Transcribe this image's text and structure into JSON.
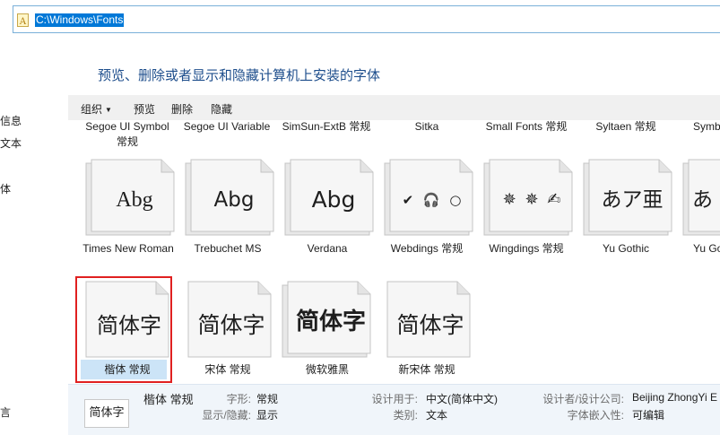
{
  "address_bar": {
    "path": "C:\\Windows\\Fonts"
  },
  "nav": {
    "items": [
      "信息",
      "文本",
      "体",
      "言"
    ]
  },
  "heading": "预览、删除或者显示和隐藏计算机上安装的字体",
  "toolbar": {
    "organize": "组织",
    "preview": "预览",
    "delete": "删除",
    "hide": "隐藏"
  },
  "top_row": [
    {
      "name": "Segoe UI Symbol 常规"
    },
    {
      "name": "Segoe UI Variable"
    },
    {
      "name": "SimSun-ExtB 常规"
    },
    {
      "name": "Sitka"
    },
    {
      "name": "Small Fonts 常规"
    },
    {
      "name": "Syltaen 常规"
    },
    {
      "name": "Symb"
    }
  ],
  "mid_row": [
    {
      "name": "Times New Roman",
      "sample": "Abg"
    },
    {
      "name": "Trebuchet MS",
      "sample": "Abg"
    },
    {
      "name": "Verdana",
      "sample": "Abg"
    },
    {
      "name": "Webdings 常规",
      "sample": "✔ 🎧 ○"
    },
    {
      "name": "Wingdings 常规",
      "sample": "✵ ✵ ✍"
    },
    {
      "name": "Yu Gothic",
      "sample": "あア亜"
    },
    {
      "name": "Yu Go",
      "sample": "あ"
    }
  ],
  "bottom_row": [
    {
      "name": "楷体 常规",
      "sample": "简体字"
    },
    {
      "name": "宋体 常规",
      "sample": "简体字"
    },
    {
      "name": "微软雅黑",
      "sample": "简体字"
    },
    {
      "name": "新宋体 常规",
      "sample": "简体字"
    }
  ],
  "details": {
    "thumb": "简体字",
    "title": "楷体 常规",
    "labels": {
      "style": "字形:",
      "show_hide": "显示/隐藏:",
      "designed_for": "设计用于:",
      "category": "类别:",
      "designer": "设计者/设计公司:",
      "embed": "字体嵌入性:"
    },
    "values": {
      "style": "常规",
      "show_hide": "显示",
      "designed_for": "中文(简体中文)",
      "category": "文本",
      "designer": "Beijing ZhongYi E",
      "embed": "可编辑"
    }
  }
}
